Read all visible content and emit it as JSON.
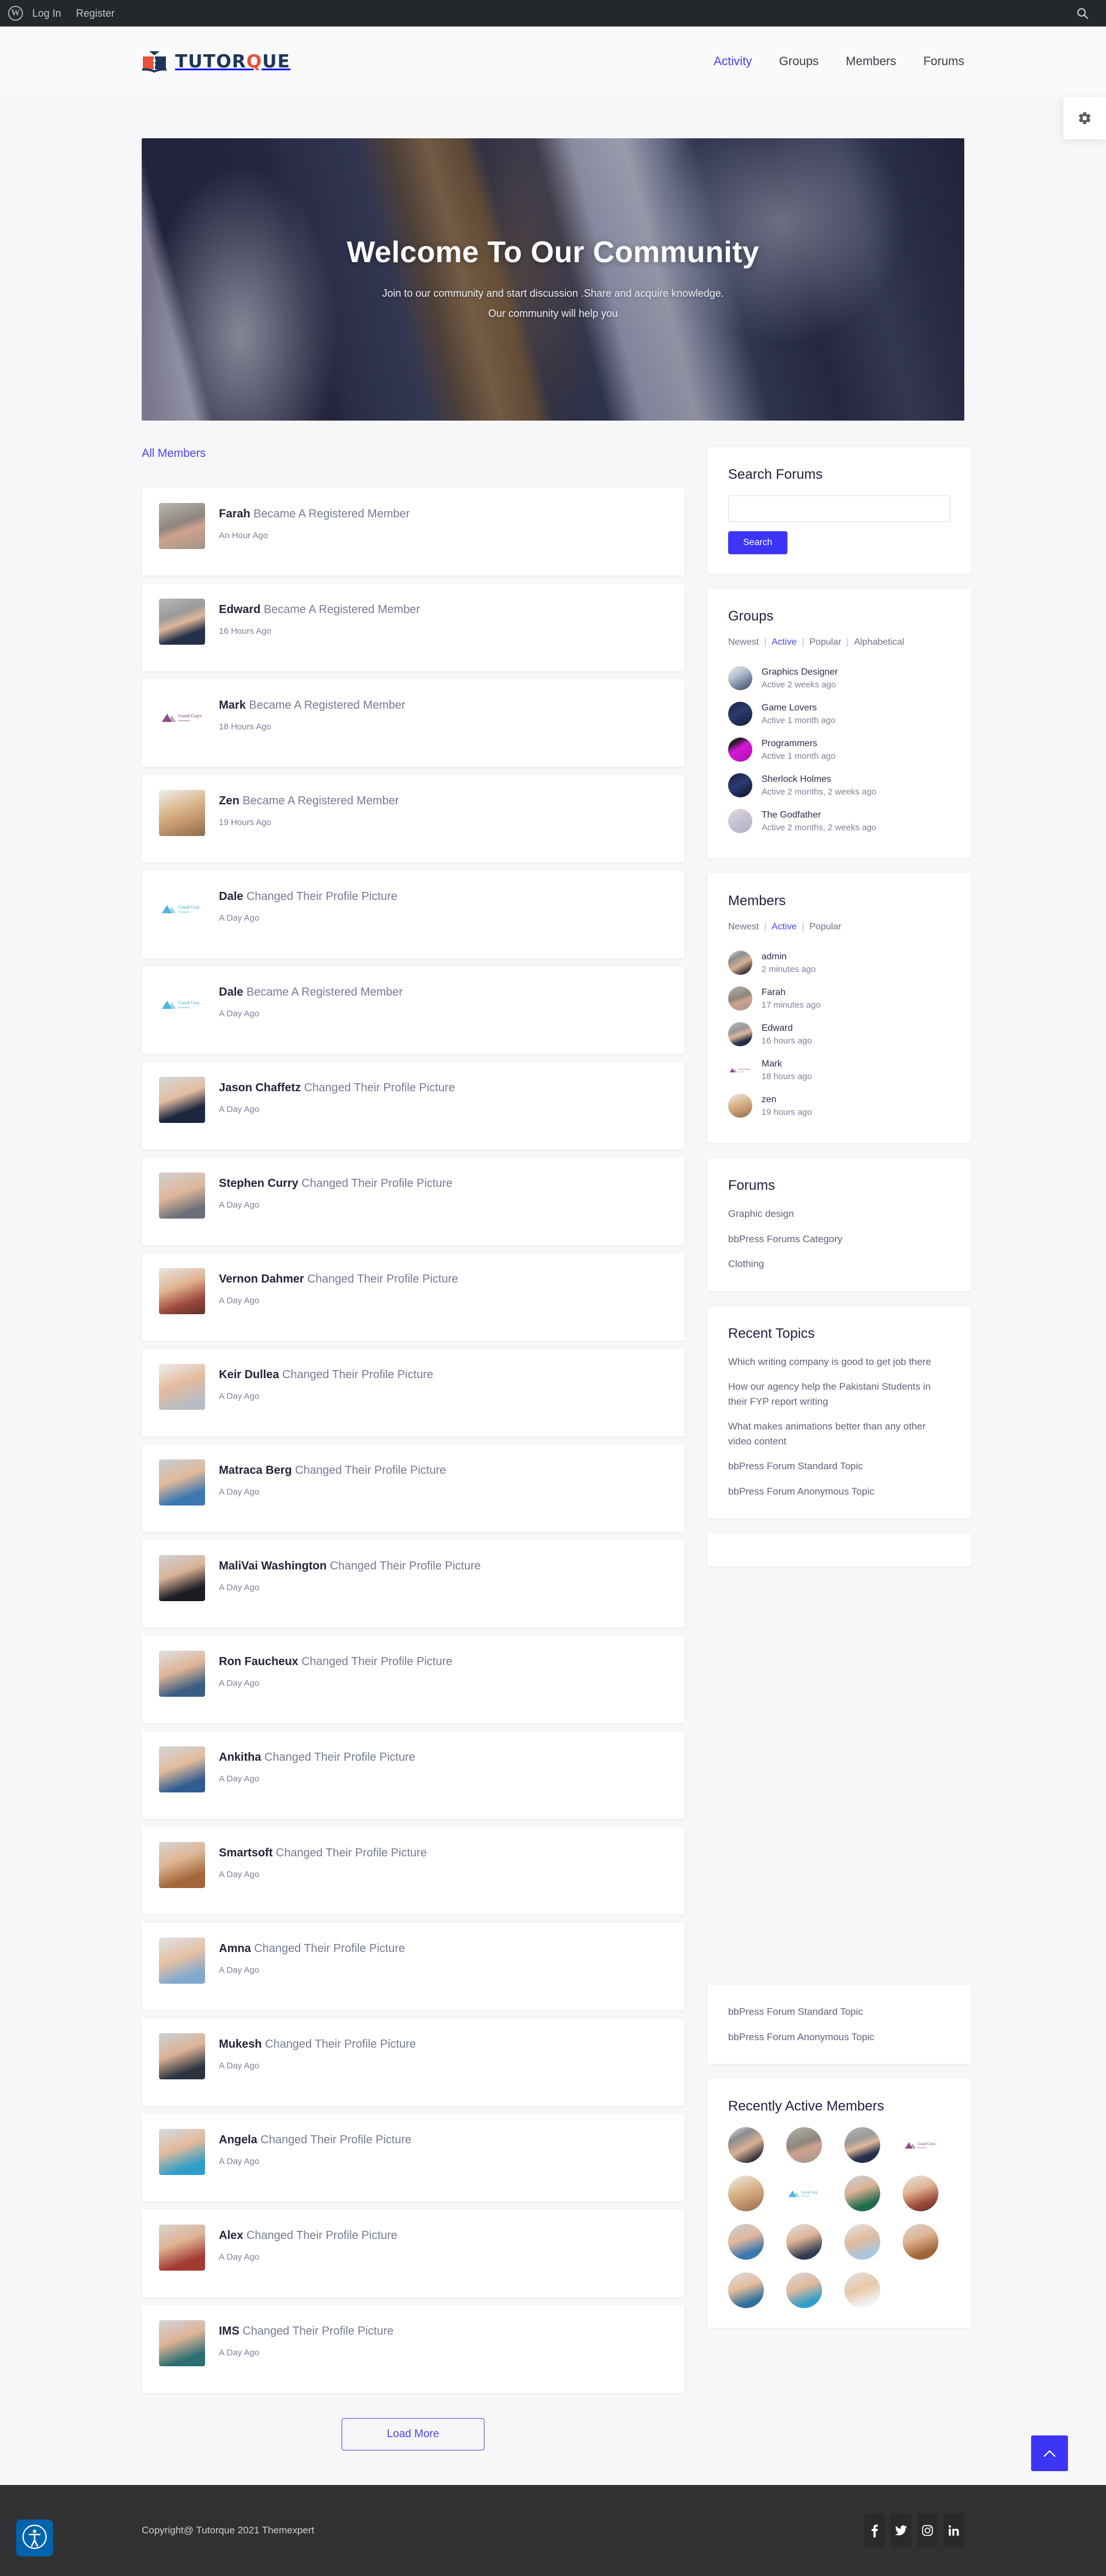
{
  "admin_bar": {
    "logo_icon": "wordpress-logo-icon",
    "links": [
      {
        "label": "Log In",
        "name": "admin-bar-login-link"
      },
      {
        "label": "Register",
        "name": "admin-bar-register-link"
      }
    ],
    "search_icon": "search-icon"
  },
  "header": {
    "brand_text_1": "TUTOR",
    "brand_accent": "Q",
    "brand_text_2": "UE",
    "brand_icon": "book-graduation-logo-icon",
    "nav": [
      {
        "label": "Activity",
        "active": true
      },
      {
        "label": "Groups",
        "active": false
      },
      {
        "label": "Members",
        "active": false
      },
      {
        "label": "Forums",
        "active": false
      }
    ],
    "settings_icon": "gear-icon"
  },
  "hero": {
    "title": "Welcome To Our Community",
    "line1": "Join to our community and start discussion .Share and acquire knowledge.",
    "line2": "Our community will help you"
  },
  "activity": {
    "filter_label": "All Members",
    "load_more_label": "Load More",
    "items": [
      {
        "name": "Farah",
        "action": "Became A Registered Member",
        "time": "An Hour Ago",
        "avatar": "woman-hijab"
      },
      {
        "name": "Edward",
        "action": "Became A Registered Member",
        "time": "16 Hours Ago",
        "avatar": "man-glasses-suit"
      },
      {
        "name": "Mark",
        "action": "Became A Registered Member",
        "time": "18 Hours Ago",
        "avatar": "goodguys-logo"
      },
      {
        "name": "Zen",
        "action": "Became A Registered Member",
        "time": "19 Hours Ago",
        "avatar": "man-blond-beard"
      },
      {
        "name": "Dale",
        "action": "Changed Their Profile Picture",
        "time": "A Day Ago",
        "avatar": "goodguy-blue-logo"
      },
      {
        "name": "Dale",
        "action": "Became A Registered Member",
        "time": "A Day Ago",
        "avatar": "goodguy-blue-logo"
      },
      {
        "name": "Jason Chaffetz",
        "action": "Changed Their Profile Picture",
        "time": "A Day Ago",
        "avatar": "man-navy-suit"
      },
      {
        "name": "Stephen Curry",
        "action": "Changed Their Profile Picture",
        "time": "A Day Ago",
        "avatar": "man-grey-bg"
      },
      {
        "name": "Vernon Dahmer",
        "action": "Changed Their Profile Picture",
        "time": "A Day Ago",
        "avatar": "man-plaid-shirt"
      },
      {
        "name": "Keir Dullea",
        "action": "Changed Their Profile Picture",
        "time": "A Day Ago",
        "avatar": "man-light-bg"
      },
      {
        "name": "Matraca Berg",
        "action": "Changed Their Profile Picture",
        "time": "A Day Ago",
        "avatar": "man-blue-shirt"
      },
      {
        "name": "MaliVai Washington",
        "action": "Changed Their Profile Picture",
        "time": "A Day Ago",
        "avatar": "man-dark-suit"
      },
      {
        "name": "Ron Faucheux",
        "action": "Changed Their Profile Picture",
        "time": "A Day Ago",
        "avatar": "man-denim"
      },
      {
        "name": "Ankitha",
        "action": "Changed Their Profile Picture",
        "time": "A Day Ago",
        "avatar": "man-blue-jacket"
      },
      {
        "name": "Smartsoft",
        "action": "Changed Their Profile Picture",
        "time": "A Day Ago",
        "avatar": "man-brown-jacket"
      },
      {
        "name": "Amna",
        "action": "Changed Their Profile Picture",
        "time": "A Day Ago",
        "avatar": "man-lightblue"
      },
      {
        "name": "Mukesh",
        "action": "Changed Their Profile Picture",
        "time": "A Day Ago",
        "avatar": "man-dark-shirt"
      },
      {
        "name": "Angela",
        "action": "Changed Their Profile Picture",
        "time": "A Day Ago",
        "avatar": "man-cyan-shirt"
      },
      {
        "name": "Alex",
        "action": "Changed Their Profile Picture",
        "time": "A Day Ago",
        "avatar": "man-red-shirt"
      },
      {
        "name": "IMS",
        "action": "Changed Their Profile Picture",
        "time": "A Day Ago",
        "avatar": "man-teal-shirt"
      }
    ]
  },
  "sidebar": {
    "search_forums": {
      "title": "Search Forums",
      "input_value": "",
      "input_placeholder": "",
      "button_label": "Search"
    },
    "groups": {
      "title": "Groups",
      "filters": [
        {
          "label": "Newest",
          "active": false
        },
        {
          "label": "Active",
          "active": true
        },
        {
          "label": "Popular",
          "active": false
        },
        {
          "label": "Alphabetical",
          "active": false
        }
      ],
      "items": [
        {
          "name": "Graphics Designer",
          "meta": "Active 2 weeks ago",
          "avatar": "laptop-desk"
        },
        {
          "name": "Game Lovers",
          "meta": "Active 1 month ago",
          "avatar": "dark-keyboard"
        },
        {
          "name": "Programmers",
          "meta": "Active 1 month ago",
          "avatar": "magenta-abstract"
        },
        {
          "name": "Sherlock Holmes",
          "meta": "Active 2 months, 2 weeks ago",
          "avatar": "dark-blue-scene"
        },
        {
          "name": "The Godfather",
          "meta": "Active 2 months, 2 weeks ago",
          "avatar": "pale-scene"
        }
      ]
    },
    "members": {
      "title": "Members",
      "filters": [
        {
          "label": "Newest",
          "active": false
        },
        {
          "label": "Active",
          "active": true
        },
        {
          "label": "Popular",
          "active": false
        }
      ],
      "items": [
        {
          "name": "admin",
          "meta": "2 minutes ago",
          "avatar": "man-beard-monitor"
        },
        {
          "name": "Farah",
          "meta": "17 minutes ago",
          "avatar": "woman-hijab"
        },
        {
          "name": "Edward",
          "meta": "16 hours ago",
          "avatar": "man-glasses-suit"
        },
        {
          "name": "Mark",
          "meta": "18 hours ago",
          "avatar": "goodguys-logo"
        },
        {
          "name": "zen",
          "meta": "19 hours ago",
          "avatar": "man-blond-beard"
        }
      ]
    },
    "forums": {
      "title": "Forums",
      "items": [
        "Graphic design",
        "bbPress Forums Category",
        "Clothing"
      ]
    },
    "recent_topics": {
      "title": "Recent Topics",
      "items": [
        "Which writing company is good to get job there",
        "How our agency help the Pakistani Students in their FYP report writing",
        "What makes animations better than any other video content",
        "bbPress Forum Standard Topic",
        "bbPress Forum Anonymous Topic"
      ]
    },
    "recent_replies": {
      "items": [
        "bbPress Forum Standard Topic",
        "bbPress Forum Anonymous Topic"
      ]
    },
    "recently_active_members": {
      "title": "Recently Active Members",
      "avatars": [
        "man-beard-monitor",
        "woman-hijab",
        "man-glasses-suit",
        "goodguys-logo",
        "man-blond-beard",
        "goodguy-blue-logo",
        "man-green-hoodie",
        "man-plaid-shirt",
        "man-blue-shirt",
        "man-denim-jacket",
        "man-glasses-lightblue",
        "man-brown-jacket",
        "man-denim-smile",
        "man-cyan-shirt",
        "man-asian-white"
      ]
    }
  },
  "scroll_top": {
    "icon": "chevron-up-icon"
  },
  "accessibility": {
    "icon": "accessibility-person-icon"
  },
  "footer": {
    "copyright": "Copyright@ Tutorque 2021  Themexpert",
    "socials": [
      {
        "name": "facebook-icon",
        "label": "f"
      },
      {
        "name": "twitter-icon",
        "label": "t"
      },
      {
        "name": "instagram-icon",
        "label": "i"
      },
      {
        "name": "linkedin-icon",
        "label": "in"
      }
    ]
  },
  "colors": {
    "accent_blue": "#3d35f5",
    "link_blue": "#4a46f0",
    "brand_navy": "#1d3557",
    "brand_red": "#e8503a",
    "adminbar": "#23282d",
    "footer": "#313133"
  }
}
